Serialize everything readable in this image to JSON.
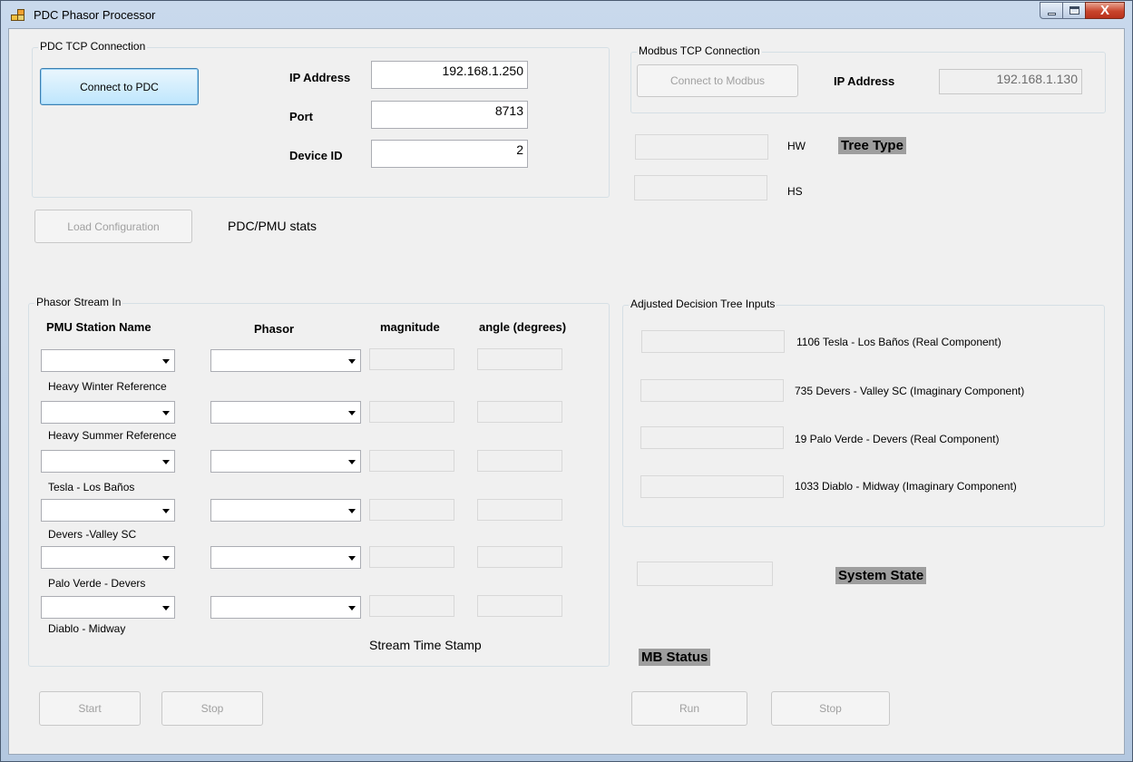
{
  "window": {
    "title": "PDC Phasor Processor",
    "close_glyph": "X"
  },
  "pdc_group": {
    "title": "PDC TCP Connection",
    "connect_label": "Connect to PDC",
    "ip_label": "IP Address",
    "ip_value": "192.168.1.250",
    "port_label": "Port",
    "port_value": "8713",
    "device_label": "Device ID",
    "device_value": "2"
  },
  "modbus_group": {
    "title": "Modbus TCP Connection",
    "connect_label": "Connect to Modbus",
    "ip_label": "IP Address",
    "ip_value": "192.168.1.130"
  },
  "hw_label": "HW",
  "hs_label": "HS",
  "tree_type_label": "Tree Type",
  "load_config_label": "Load Configuration",
  "stats_label": "PDC/PMU stats",
  "phasor_group": {
    "title": "Phasor Stream In",
    "headers": {
      "station": "PMU Station Name",
      "phasor": "Phasor",
      "magnitude": "magnitude",
      "angle": "angle (degrees)"
    },
    "row_labels": [
      "Heavy Winter Reference",
      "Heavy Summer Reference",
      "Tesla - Los Baños",
      "Devers -Valley SC",
      "Palo Verde - Devers",
      "Diablo - Midway"
    ],
    "timestamp_label": "Stream Time Stamp"
  },
  "tree_group": {
    "title": "Adjusted Decision Tree Inputs",
    "items": [
      "1106 Tesla - Los Baños (Real Component)",
      "735 Devers - Valley SC (Imaginary Component)",
      "19 Palo Verde - Devers (Real Component)",
      "1033 Diablo - Midway (Imaginary Component)"
    ]
  },
  "system_state_label": "System State",
  "mb_status_label": "MB Status",
  "buttons": {
    "start": "Start",
    "stop": "Stop",
    "run": "Run",
    "stop2": "Stop"
  }
}
